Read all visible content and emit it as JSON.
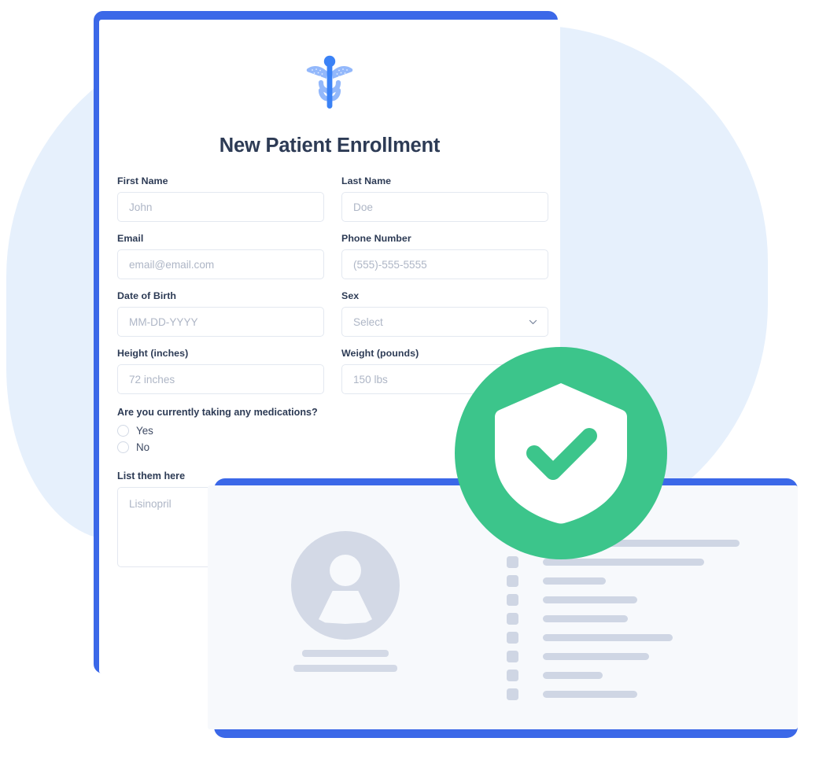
{
  "theme": {
    "accent_blue": "#3B68E8",
    "icon_blue_dark": "#3B82F6",
    "icon_blue_light": "#93B8FB",
    "blob_blue": "#E6F0FC",
    "success_green": "#3CC58B",
    "label_navy": "#2D3B55",
    "placeholder_gray": "#AEB6C6",
    "skeleton_gray": "#CFD6E4",
    "card_bg": "#F7F9FC"
  },
  "form": {
    "logo_icon": "caduceus-icon",
    "title": "New Patient Enrollment",
    "fields": [
      {
        "label": "First Name",
        "placeholder": "John",
        "name": "first-name",
        "type": "text"
      },
      {
        "label": "Last Name",
        "placeholder": "Doe",
        "name": "last-name",
        "type": "text"
      },
      {
        "label": "Email",
        "placeholder": "email@email.com",
        "name": "email",
        "type": "text"
      },
      {
        "label": "Phone Number",
        "placeholder": "(555)-555-5555",
        "name": "phone-number",
        "type": "text"
      },
      {
        "label": "Date of Birth",
        "placeholder": "MM-DD-YYYY",
        "name": "date-of-birth",
        "type": "text"
      },
      {
        "label": "Sex",
        "placeholder": "Select",
        "name": "sex",
        "type": "select",
        "chevron_icon": "chevron-down-icon"
      },
      {
        "label": "Height (inches)",
        "placeholder": "72 inches",
        "name": "height",
        "type": "text"
      },
      {
        "label": "Weight (pounds)",
        "placeholder": "150 lbs",
        "name": "weight",
        "type": "text"
      }
    ],
    "question": {
      "text": "Are you currently taking any medications?",
      "options": [
        {
          "label": "Yes",
          "selected": false
        },
        {
          "label": "No",
          "selected": false
        }
      ]
    },
    "medications": {
      "label": "List them here",
      "placeholder": "Lisinopril"
    }
  },
  "badge": {
    "icon": "shield-check-icon",
    "color": "#3CC58B"
  },
  "record_card": {
    "avatar": {
      "icon": "user-avatar-icon",
      "bars": [
        110,
        132
      ]
    },
    "list_rows": [
      {
        "bullet": true,
        "line_width": 190
      },
      {
        "bullet": true,
        "line_width": 205
      },
      {
        "bullet": true,
        "line_width": 80
      },
      {
        "bullet": true,
        "line_width": 120
      },
      {
        "bullet": true,
        "line_width": 108
      },
      {
        "bullet": true,
        "line_width": 165
      },
      {
        "bullet": true,
        "line_width": 135
      },
      {
        "bullet": true,
        "line_width": 76
      },
      {
        "bullet": true,
        "line_width": 120
      }
    ]
  }
}
